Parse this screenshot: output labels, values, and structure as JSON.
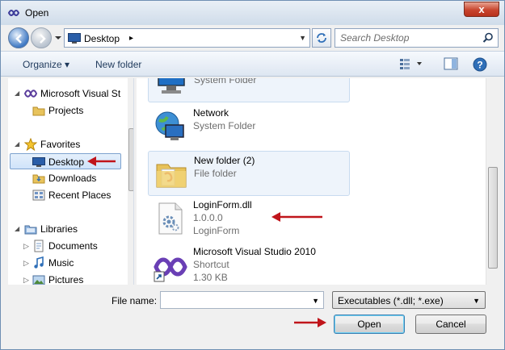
{
  "window": {
    "title": "Open",
    "close_glyph": "x"
  },
  "address": {
    "location": "Desktop",
    "chevron": "▸"
  },
  "search": {
    "placeholder": "Search Desktop"
  },
  "toolbar": {
    "organize": "Organize ▾",
    "new_folder": "New folder"
  },
  "nav_tree": {
    "items": [
      {
        "label": "Microsoft Visual St",
        "icon": "visual-studio-icon"
      },
      {
        "label": "Projects",
        "icon": "folder-icon"
      },
      {
        "label": "Favorites",
        "icon": "star-icon"
      },
      {
        "label": "Desktop",
        "icon": "desktop-icon",
        "selected": true
      },
      {
        "label": "Downloads",
        "icon": "folder-icon"
      },
      {
        "label": "Recent Places",
        "icon": "recent-places-icon"
      },
      {
        "label": "Libraries",
        "icon": "libraries-icon"
      },
      {
        "label": "Documents",
        "icon": "documents-icon"
      },
      {
        "label": "Music",
        "icon": "music-icon"
      },
      {
        "label": "Pictures",
        "icon": "pictures-icon"
      }
    ]
  },
  "files": [
    {
      "name": "",
      "sub1": "System Folder",
      "sub2": "",
      "icon": "computer-icon"
    },
    {
      "name": "Network",
      "sub1": "System Folder",
      "sub2": "",
      "icon": "network-icon"
    },
    {
      "name": "New folder (2)",
      "sub1": "File folder",
      "sub2": "",
      "icon": "folder-icon"
    },
    {
      "name": "LoginForm.dll",
      "sub1": "1.0.0.0",
      "sub2": "LoginForm",
      "icon": "dll-file-icon"
    },
    {
      "name": "Microsoft Visual Studio 2010",
      "sub1": "Shortcut",
      "sub2": "1.30 KB",
      "icon": "visual-studio-icon"
    }
  ],
  "bottom": {
    "file_name_label": "File name:",
    "file_name_value": "",
    "file_type": "Executables (*.dll; *.exe)",
    "open_label": "Open",
    "cancel_label": "Cancel"
  },
  "colors": {
    "accent": "#3f79c4",
    "arrow": "#c0151b",
    "selection": "#cfe3fa"
  }
}
